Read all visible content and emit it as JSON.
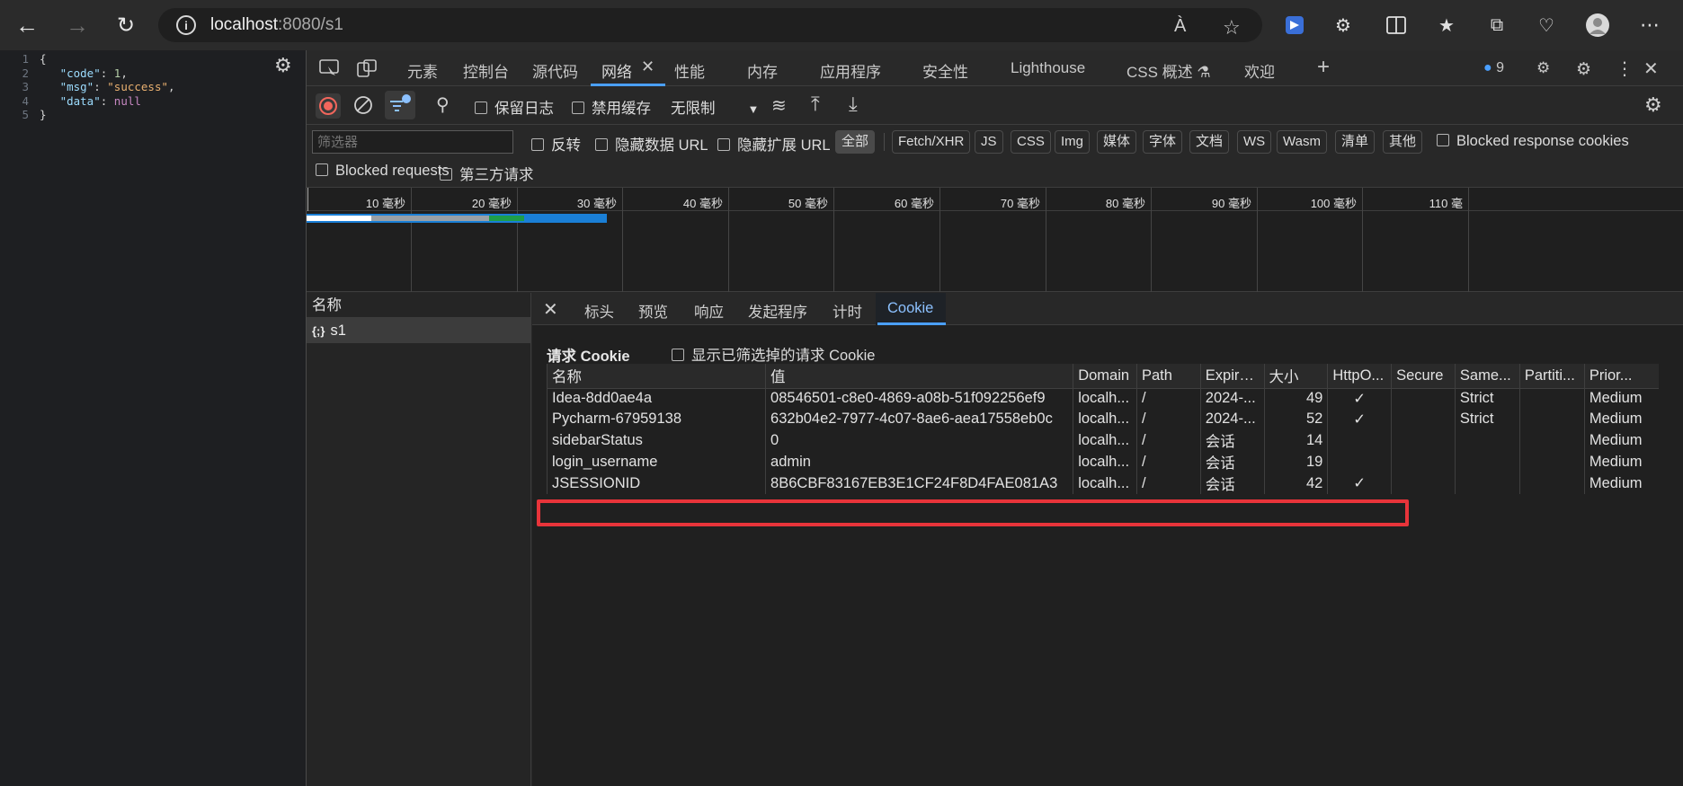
{
  "browser": {
    "url_host": "localhost",
    "url_rest": ":8080/s1",
    "read_aloud": "À",
    "profile": "user"
  },
  "page": {
    "gear": "⚙",
    "code_lines": [
      {
        "n": "1",
        "text": "{"
      },
      {
        "n": "2",
        "key": "\"code\"",
        "sep": ": ",
        "val": "1",
        "vtype": "num",
        "end": ","
      },
      {
        "n": "3",
        "key": "\"msg\"",
        "sep": ": ",
        "val": "\"success\"",
        "vtype": "str",
        "end": ","
      },
      {
        "n": "4",
        "key": "\"data\"",
        "sep": ": ",
        "val": "null",
        "vtype": "null",
        "end": ""
      },
      {
        "n": "5",
        "text": "}"
      }
    ]
  },
  "devtools": {
    "tabs": [
      "元素",
      "控制台",
      "源代码",
      "网络",
      "性能",
      "内存",
      "应用程序",
      "安全性",
      "Lighthouse",
      "CSS 概述 ⚗",
      "欢迎"
    ],
    "issues_count": "9",
    "toolbar": {
      "preserve_log": "保留日志",
      "disable_cache": "禁用缓存",
      "throttle": "无限制"
    },
    "filter": {
      "placeholder": "筛选器",
      "invert": "反转",
      "hide_data_url": "隐藏数据 URL",
      "hide_ext_url": "隐藏扩展 URL",
      "types": [
        "全部",
        "Fetch/XHR",
        "JS",
        "CSS",
        "Img",
        "媒体",
        "字体",
        "文档",
        "WS",
        "Wasm",
        "清单",
        "其他"
      ],
      "blocked_cookies": "Blocked response cookies",
      "blocked_requests": "Blocked requests",
      "third_party": "第三方请求"
    },
    "timeline": {
      "ticks": [
        "10 毫秒",
        "20 毫秒",
        "30 毫秒",
        "40 毫秒",
        "50 毫秒",
        "60 毫秒",
        "70 毫秒",
        "80 毫秒",
        "90 毫秒",
        "100 毫秒",
        "110 毫"
      ]
    },
    "requests": {
      "header": "名称",
      "items": [
        {
          "icon": "{;}",
          "name": "s1"
        }
      ]
    },
    "detail_tabs": [
      "标头",
      "预览",
      "响应",
      "发起程序",
      "计时",
      "Cookie"
    ],
    "cookies": {
      "section_title": "请求 Cookie",
      "show_filtered": "显示已筛选掉的请求 Cookie",
      "columns": [
        "名称",
        "值",
        "Domain",
        "Path",
        "Expire...",
        "大小",
        "HttpO...",
        "Secure",
        "Same...",
        "Partiti...",
        "Prior..."
      ],
      "rows": [
        [
          "Idea-8dd0ae4a",
          "08546501-c8e0-4869-a08b-51f092256ef9",
          "localh...",
          "/",
          "2024-...",
          "49",
          "✓",
          "",
          "Strict",
          "",
          "Medium"
        ],
        [
          "Pycharm-67959138",
          "632b04e2-7977-4c07-8ae6-aea17558eb0c",
          "localh...",
          "/",
          "2024-...",
          "52",
          "✓",
          "",
          "Strict",
          "",
          "Medium"
        ],
        [
          "sidebarStatus",
          "0",
          "localh...",
          "/",
          "会话",
          "14",
          "",
          "",
          "",
          "",
          "Medium"
        ],
        [
          "login_username",
          "admin",
          "localh...",
          "/",
          "会话",
          "19",
          "",
          "",
          "",
          "",
          "Medium"
        ],
        [
          "JSESSIONID",
          "8B6CBF83167EB3E1CF24F8D4FAE081A3",
          "localh...",
          "/",
          "会话",
          "42",
          "✓",
          "",
          "",
          "",
          "Medium"
        ]
      ]
    }
  }
}
